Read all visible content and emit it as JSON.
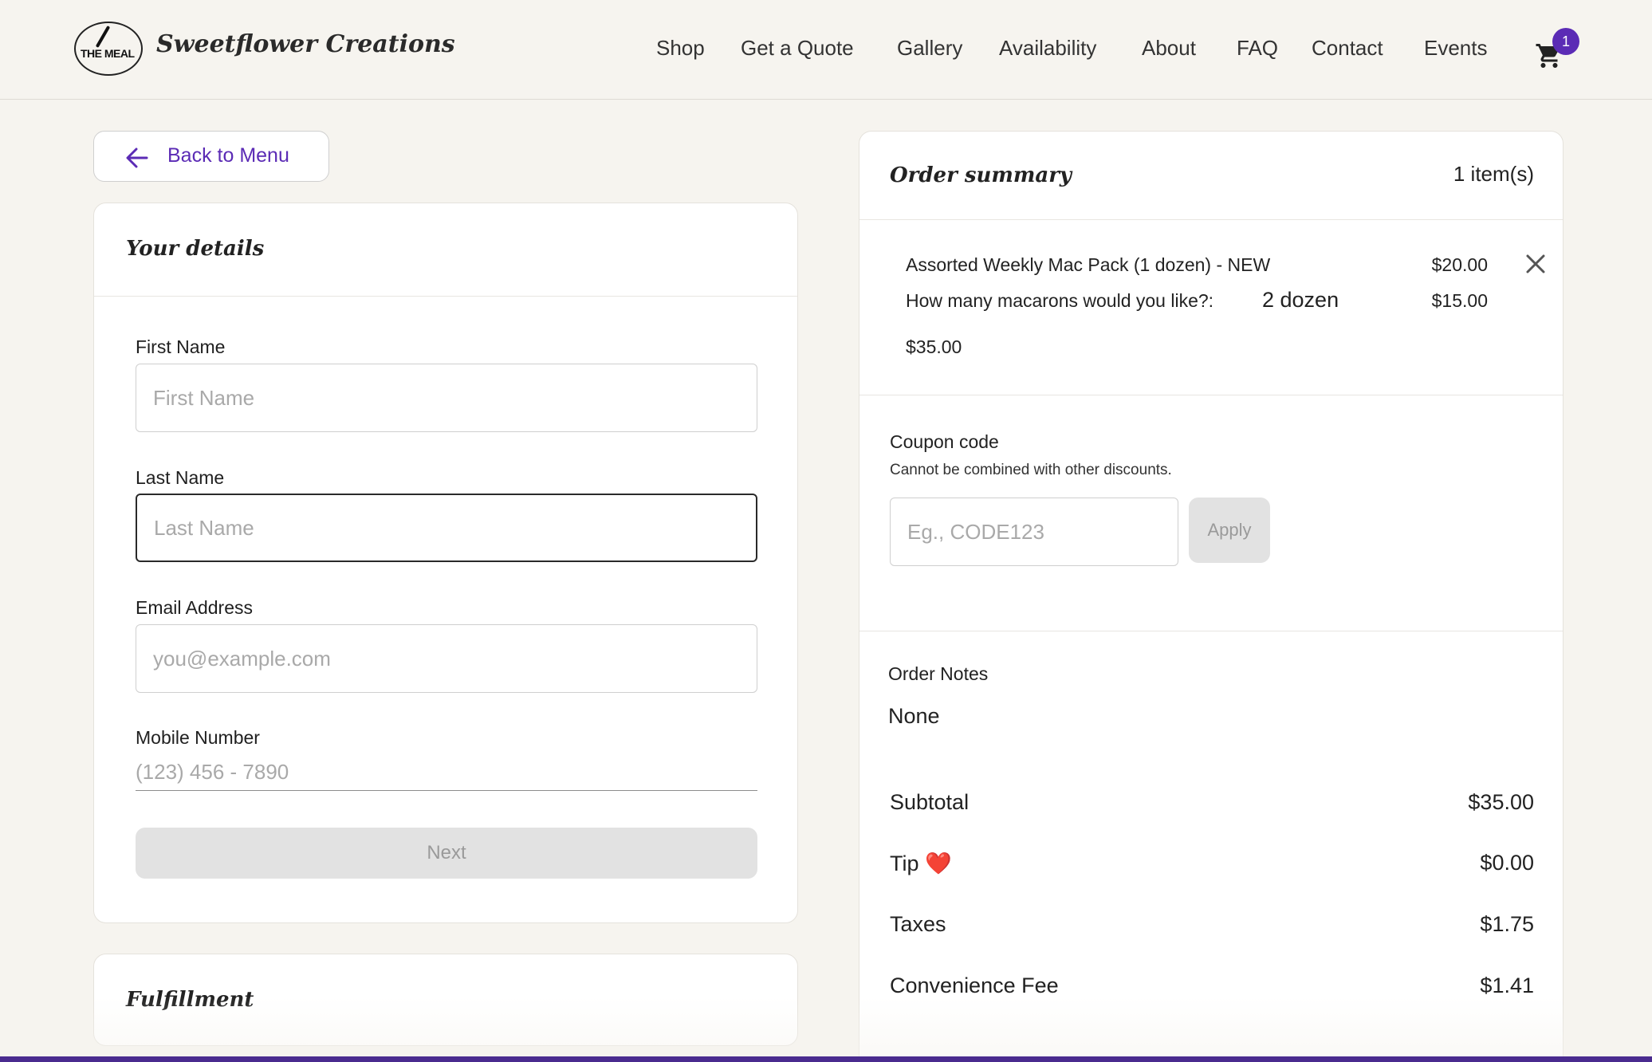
{
  "header": {
    "logo_text": "THE MEAL",
    "brand_name": "Sweetflower Creations",
    "nav": [
      "Shop",
      "Get a Quote",
      "Gallery",
      "Availability",
      "About",
      "FAQ",
      "Contact",
      "Events"
    ],
    "cart_count": "1",
    "cart_icon": "shopping-cart-icon"
  },
  "back_button": {
    "label": "Back to Menu",
    "icon": "arrow-left-icon"
  },
  "details": {
    "title": "Your details",
    "first_name": {
      "label": "First Name",
      "placeholder": "First Name",
      "value": ""
    },
    "last_name": {
      "label": "Last Name",
      "placeholder": "Last Name",
      "value": ""
    },
    "email": {
      "label": "Email Address",
      "placeholder": "you@example.com",
      "value": ""
    },
    "mobile": {
      "label": "Mobile Number",
      "placeholder": "(123) 456 - 7890",
      "value": ""
    },
    "next_label": "Next"
  },
  "fulfillment": {
    "title": "Fulfillment"
  },
  "summary": {
    "title": "Order summary",
    "count": "1 item(s)",
    "item": {
      "name": "Assorted Weekly Mac Pack (1 dozen) - NEW",
      "price": "$20.00",
      "option_question": "How many macarons would you like?:",
      "option_value": "2 dozen",
      "option_price": "$15.00",
      "line_total": "$35.00"
    },
    "coupon": {
      "label": "Coupon code",
      "note": "Cannot be combined with other discounts.",
      "placeholder": "Eg., CODE123",
      "apply_label": "Apply"
    },
    "notes": {
      "label": "Order Notes",
      "value": "None"
    },
    "totals": {
      "subtotal_label": "Subtotal",
      "subtotal": "$35.00",
      "tip_label": "Tip",
      "tip_emoji": "❤️",
      "tip": "$0.00",
      "taxes_label": "Taxes",
      "taxes": "$1.75",
      "fee_label": "Convenience Fee",
      "fee": "$1.41"
    }
  },
  "colors": {
    "accent": "#5b2bb5",
    "background": "#f6f4ef",
    "bottom_bar": "#4a2b8f"
  }
}
